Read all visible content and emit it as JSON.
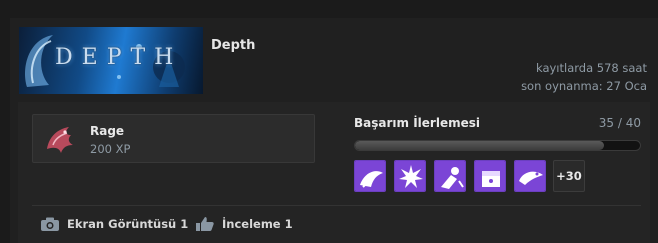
{
  "game": {
    "name": "Depth",
    "banner_text": "DEPTH",
    "hours_on_record": "kayıtlarda 578 saat",
    "last_played": "son oynanma: 27 Oca"
  },
  "xp": {
    "title": "Rage",
    "points": "200 XP",
    "badge_icon": "rage-badge-icon"
  },
  "achievements": {
    "label": "Başarım İlerlemesi",
    "count": "35 / 40",
    "progress": 0.875,
    "icons": [
      {
        "icon": "achievement-shark-icon"
      },
      {
        "icon": "achievement-explosion-icon"
      },
      {
        "icon": "achievement-diver-icon"
      },
      {
        "icon": "achievement-treasure-icon"
      },
      {
        "icon": "achievement-shark-bite-icon"
      }
    ],
    "more": "+30",
    "accent": "#7b45d6"
  },
  "footer": {
    "screenshots": "Ekran Görüntüsü 1",
    "reviews": "İnceleme 1"
  }
}
